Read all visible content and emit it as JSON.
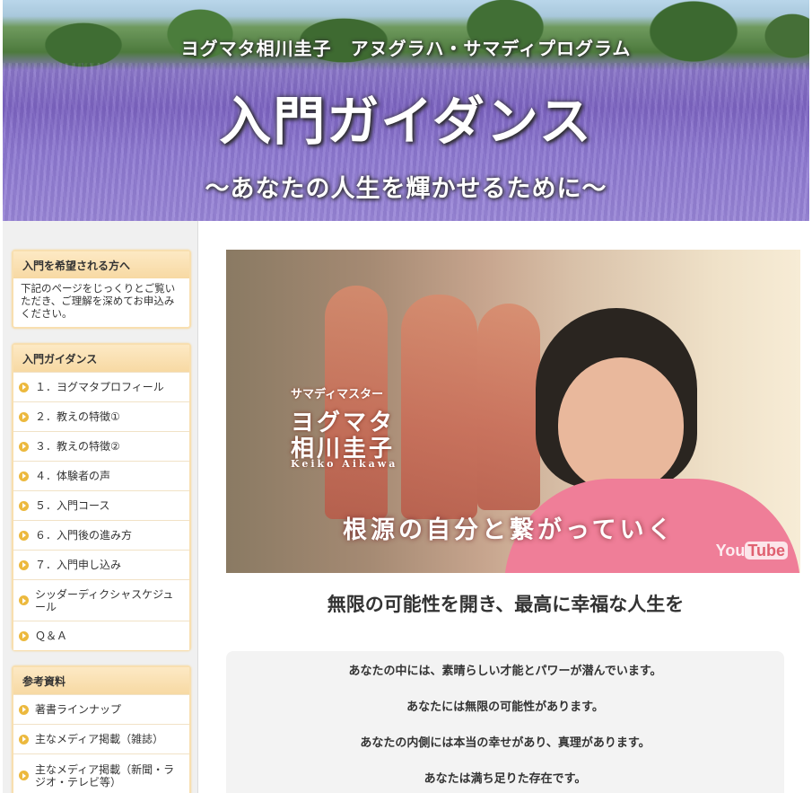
{
  "header": {
    "subtitle": "ヨグマタ相川圭子　アヌグラハ・サマディプログラム",
    "title": "入門ガイダンス",
    "tagline": "〜あなたの人生を輝かせるために〜"
  },
  "sidebar": {
    "intro": {
      "heading": "入門を希望される方へ",
      "text": "下記のページをじっくりとご覧いただき、ご理解を深めてお申込みください。"
    },
    "guidance": {
      "heading": "入門ガイダンス",
      "items": [
        "１．ヨグマタプロフィール",
        "２．教えの特徴①",
        "３．教えの特徴②",
        "４．体験者の声",
        "５．入門コース",
        "６．入門後の進み方",
        "７．入門申し込み",
        "シッダーディクシャスケジュール",
        "Ｑ＆Ａ"
      ]
    },
    "references": {
      "heading": "参考資料",
      "items": [
        "著書ラインナップ",
        "主なメディア掲載（雑誌）",
        "主なメディア掲載（新聞・ラジオ・テレビ等）"
      ]
    }
  },
  "video": {
    "role": "サマディマスター",
    "name_line1": "ヨグマタ",
    "name_line2": "相川圭子",
    "name_roman": "Keiko Aikawa",
    "caption": "根源の自分と繋がっていく",
    "logo_you": "You",
    "logo_tube": "Tube"
  },
  "main": {
    "headline": "無限の可能性を開き、最高に幸福な人生を",
    "message": [
      "あなたの中には、素晴らしい才能とパワーが潜んでいます。",
      "あなたには無限の可能性があります。",
      "あなたの内側には本当の幸せがあり、真理があります。",
      "あなたは満ち足りた存在です。"
    ]
  }
}
